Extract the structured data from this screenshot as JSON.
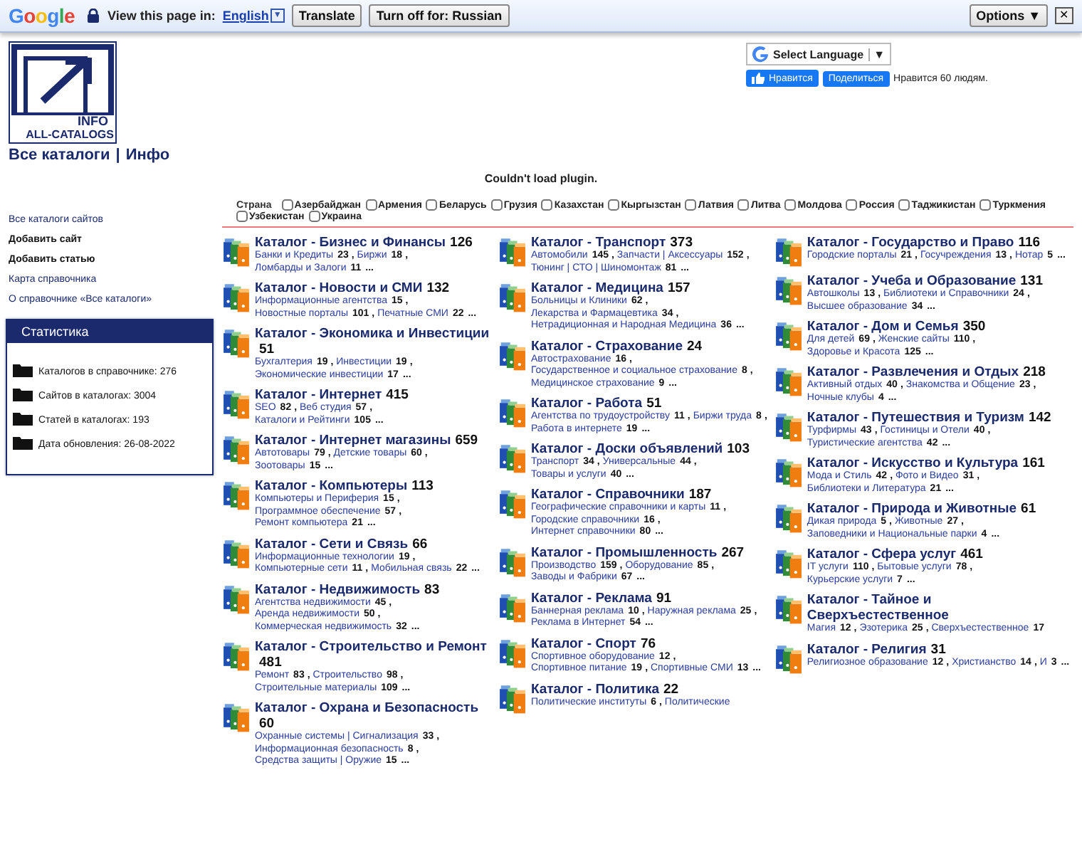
{
  "translate_bar": {
    "logo": "Google",
    "prompt": "View this page in:",
    "language": "English",
    "language_arrow": "▼",
    "translate_button": "Translate",
    "turn_off_button": "Turn off for: Russian",
    "options_button": "Options ▼",
    "close": "✕"
  },
  "header": {
    "logo_line1": "INFO",
    "logo_line2": "ALL-CATALOGS",
    "nav": [
      "Все каталоги",
      "Инфо"
    ],
    "nav_separator": "|"
  },
  "language_widget": {
    "label": "Select Language",
    "arrow": "▼"
  },
  "facebook": {
    "like": "Нравится",
    "share": "Поделиться",
    "count_text": "Нравится 60 людям."
  },
  "plugin_message": "Couldn't load plugin.",
  "sidebar": {
    "links": [
      {
        "label": "Все каталоги сайтов",
        "bold": false
      },
      {
        "label": "Добавить сайт",
        "bold": true
      },
      {
        "label": "Добавить статью",
        "bold": true
      },
      {
        "label": "Карта справочника",
        "bold": false
      },
      {
        "label": "О справочнике «Все каталоги»",
        "bold": false
      }
    ],
    "stats": {
      "title": "Статистика",
      "items": [
        "Каталогов в справочнике: 276",
        "Сайтов в каталогах: 3004",
        "Статей в каталогах: 193",
        "Дата обновления: 26-08-2022"
      ]
    }
  },
  "countries": {
    "label": "Страна",
    "options": [
      {
        "label": "Азербайджан",
        "checked": false
      },
      {
        "label": "Армения",
        "checked": false
      },
      {
        "label": "Беларусь",
        "checked": false
      },
      {
        "label": "Грузия",
        "checked": false
      },
      {
        "label": "Казахстан",
        "checked": false
      },
      {
        "label": "Кыргызстан",
        "checked": false
      },
      {
        "label": "Латвия",
        "checked": false
      },
      {
        "label": "Литва",
        "checked": false
      },
      {
        "label": "Молдова",
        "checked": false
      },
      {
        "label": "Россия",
        "checked": false
      },
      {
        "label": "Таджикистан",
        "checked": false
      },
      {
        "label": "Туркмения",
        "checked": false
      },
      {
        "label": "Узбекистан",
        "checked": false
      },
      {
        "label": "Украина",
        "checked": false
      }
    ]
  },
  "catalogs": {
    "separator": ",",
    "columns": [
      [
        {
          "title": "Каталог - Бизнес и Финансы",
          "count": "126",
          "subs": [
            {
              "name": "Банки и Кредиты",
              "count": "23"
            },
            {
              "name": "Биржи",
              "count": "18"
            },
            {
              "name": "Ломбарды и Залоги",
              "count": "11"
            }
          ],
          "more": "..."
        },
        {
          "title": "Каталог - Новости и СМИ",
          "count": "132",
          "subs": [
            {
              "name": "Информационные агентства",
              "count": "15"
            },
            {
              "name": "Новостные порталы",
              "count": "101"
            },
            {
              "name": "Печатные СМИ",
              "count": "22"
            }
          ],
          "more": "..."
        },
        {
          "title": "Каталог - Экономика и Инвестиции",
          "count": "51",
          "subs": [
            {
              "name": "Бухгалтерия",
              "count": "19"
            },
            {
              "name": "Инвестиции",
              "count": "19"
            },
            {
              "name": "Экономические инвестиции",
              "count": "17"
            }
          ],
          "more": "..."
        },
        {
          "title": "Каталог - Интернет",
          "count": "415",
          "subs": [
            {
              "name": "SEO",
              "count": "82"
            },
            {
              "name": "Веб студия",
              "count": "57"
            },
            {
              "name": "Каталоги и Рейтинги",
              "count": "105"
            }
          ],
          "more": "..."
        },
        {
          "title": "Каталог - Интернет магазины",
          "count": "659",
          "subs": [
            {
              "name": "Автотовары",
              "count": "79"
            },
            {
              "name": "Детские товары",
              "count": "60"
            },
            {
              "name": "Зоотовары",
              "count": "15"
            }
          ],
          "more": "..."
        },
        {
          "title": "Каталог - Компьютеры",
          "count": "113",
          "subs": [
            {
              "name": "Компьютеры и Периферия",
              "count": "15"
            },
            {
              "name": "Программное обеспечение",
              "count": "57"
            },
            {
              "name": "Ремонт компьютера",
              "count": "21"
            }
          ],
          "more": "..."
        },
        {
          "title": "Каталог - Сети и Связь",
          "count": "66",
          "subs": [
            {
              "name": "Информационные технологии",
              "count": "19"
            },
            {
              "name": "Компьютерные сети",
              "count": "11"
            },
            {
              "name": "Мобильная связь",
              "count": "22"
            }
          ],
          "more": "..."
        },
        {
          "title": "Каталог - Недвижимость",
          "count": "83",
          "subs": [
            {
              "name": "Агентства недвижимости",
              "count": "45"
            },
            {
              "name": "Аренда недвижимости",
              "count": "50"
            },
            {
              "name": "Коммерческая недвижимость",
              "count": "32"
            }
          ],
          "more": "..."
        },
        {
          "title": "Каталог - Строительство и Ремонт",
          "count": "481",
          "subs": [
            {
              "name": "Ремонт",
              "count": "83"
            },
            {
              "name": "Строительство",
              "count": "98"
            },
            {
              "name": "Строительные материалы",
              "count": "109"
            }
          ],
          "more": "..."
        },
        {
          "title": "Каталог - Охрана и Безопасность",
          "count": "60",
          "subs": [
            {
              "name": "Охранные системы | Сигнализация",
              "count": "33"
            },
            {
              "name": "Информационная безопасность",
              "count": "8"
            },
            {
              "name": "Средства защиты | Оружие",
              "count": "15"
            }
          ],
          "more": "..."
        }
      ],
      [
        {
          "title": "Каталог - Транспорт",
          "count": "373",
          "subs": [
            {
              "name": "Автомобили",
              "count": "145"
            },
            {
              "name": "Запчасти | Аксессуары",
              "count": "152"
            },
            {
              "name": "Тюнинг | СТО | Шиномонтаж",
              "count": "81"
            }
          ],
          "more": "..."
        },
        {
          "title": "Каталог - Медицина",
          "count": "157",
          "subs": [
            {
              "name": "Больницы и Клиники",
              "count": "62"
            },
            {
              "name": "Лекарства и Фармацевтика",
              "count": "34"
            },
            {
              "name": "Нетрадиционная и Народная Медицина",
              "count": "36"
            }
          ],
          "more": "..."
        },
        {
          "title": "Каталог - Страхование",
          "count": "24",
          "subs": [
            {
              "name": "Автострахование",
              "count": "16"
            },
            {
              "name": "Государственное и социальное страхование",
              "count": "8"
            },
            {
              "name": "Медицинское страхование",
              "count": "9"
            }
          ],
          "more": "..."
        },
        {
          "title": "Каталог - Работа",
          "count": "51",
          "subs": [
            {
              "name": "Агентства по трудоустройству",
              "count": "11"
            },
            {
              "name": "Биржи труда",
              "count": "8"
            },
            {
              "name": "Работа в интернете",
              "count": "19"
            }
          ],
          "more": "..."
        },
        {
          "title": "Каталог - Доски объявлений",
          "count": "103",
          "subs": [
            {
              "name": "Транспорт",
              "count": "34"
            },
            {
              "name": "Универсальные",
              "count": "44"
            },
            {
              "name": "Товары и услуги",
              "count": "40"
            }
          ],
          "more": "..."
        },
        {
          "title": "Каталог - Справочники",
          "count": "187",
          "subs": [
            {
              "name": "Географические справочники и карты",
              "count": "11"
            },
            {
              "name": "Городские справочники",
              "count": "16"
            },
            {
              "name": "Интернет справочники",
              "count": "80"
            }
          ],
          "more": "..."
        },
        {
          "title": "Каталог - Промышленность",
          "count": "267",
          "subs": [
            {
              "name": "Производство",
              "count": "159"
            },
            {
              "name": "Оборудование",
              "count": "85"
            },
            {
              "name": "Заводы и Фабрики",
              "count": "67"
            }
          ],
          "more": "..."
        },
        {
          "title": "Каталог - Реклама",
          "count": "91",
          "subs": [
            {
              "name": "Баннерная реклама",
              "count": "10"
            },
            {
              "name": "Наружная реклама",
              "count": "25"
            },
            {
              "name": "Реклама в Интернет",
              "count": "54"
            }
          ],
          "more": "..."
        },
        {
          "title": "Каталог - Спорт",
          "count": "76",
          "subs": [
            {
              "name": "Спортивное оборудование",
              "count": "12"
            },
            {
              "name": "Спортивное питание",
              "count": "19"
            },
            {
              "name": "Спортивные СМИ",
              "count": "13"
            }
          ],
          "more": "..."
        },
        {
          "title": "Каталог - Политика",
          "count": "22",
          "subs": [
            {
              "name": "Политические институты",
              "count": "6"
            },
            {
              "name": "Политические"
            }
          ]
        }
      ],
      [
        {
          "title": "Каталог - Государство и Право",
          "count": "116",
          "subs": [
            {
              "name": "Городские порталы",
              "count": "21"
            },
            {
              "name": "Госучреждения",
              "count": "13"
            },
            {
              "name": "Нотар",
              "count": "5"
            }
          ],
          "more": "..."
        },
        {
          "title": "Каталог - Учеба и Образование",
          "count": "131",
          "subs": [
            {
              "name": "Автошколы",
              "count": "13"
            },
            {
              "name": "Библиотеки и Справочники",
              "count": "24"
            },
            {
              "name": "Высшее образование",
              "count": "34"
            }
          ],
          "more": "..."
        },
        {
          "title": "Каталог - Дом и Семья",
          "count": "350",
          "subs": [
            {
              "name": "Для детей",
              "count": "69"
            },
            {
              "name": "Женские сайты",
              "count": "110"
            },
            {
              "name": "Здоровье и Красота",
              "count": "125"
            }
          ],
          "more": "..."
        },
        {
          "title": "Каталог - Развлечения и Отдых",
          "count": "218",
          "subs": [
            {
              "name": "Активный отдых",
              "count": "40"
            },
            {
              "name": "Знакомства и Общение",
              "count": "23"
            },
            {
              "name": "Ночные клубы",
              "count": "4"
            }
          ],
          "more": "..."
        },
        {
          "title": "Каталог - Путешествия и Туризм",
          "count": "142",
          "subs": [
            {
              "name": "Турфирмы",
              "count": "43"
            },
            {
              "name": "Гостиницы и Отели",
              "count": "40"
            },
            {
              "name": "Туристические агентства",
              "count": "42"
            }
          ],
          "more": "..."
        },
        {
          "title": "Каталог - Искусство и Культура",
          "count": "161",
          "subs": [
            {
              "name": "Мода и Стиль",
              "count": "42"
            },
            {
              "name": "Фото и Видео",
              "count": "31"
            },
            {
              "name": "Библиотеки и Литература",
              "count": "21"
            }
          ],
          "more": "..."
        },
        {
          "title": "Каталог - Природа и Животные",
          "count": "61",
          "subs": [
            {
              "name": "Дикая природа",
              "count": "5"
            },
            {
              "name": "Животные",
              "count": "27"
            },
            {
              "name": "Заповедники и Национальные парки",
              "count": "4"
            }
          ],
          "more": "..."
        },
        {
          "title": "Каталог - Сфера услуг",
          "count": "461",
          "subs": [
            {
              "name": "IT услуги",
              "count": "110"
            },
            {
              "name": "Бытовые услуги",
              "count": "78"
            },
            {
              "name": "Курьерские услуги",
              "count": "7"
            }
          ],
          "more": "..."
        },
        {
          "title": "Каталог - Тайное и Сверхъестественное",
          "subs": [
            {
              "name": "Магия",
              "count": "12"
            },
            {
              "name": "Эзотерика",
              "count": "25"
            },
            {
              "name": "Сверхъестественное",
              "count": "17"
            }
          ]
        },
        {
          "title": "Каталог - Религия",
          "count": "31",
          "subs": [
            {
              "name": "Религиозное образование",
              "count": "12"
            },
            {
              "name": "Христианство",
              "count": "14"
            },
            {
              "name": "И",
              "count": "3"
            }
          ],
          "more": "..."
        }
      ]
    ]
  }
}
